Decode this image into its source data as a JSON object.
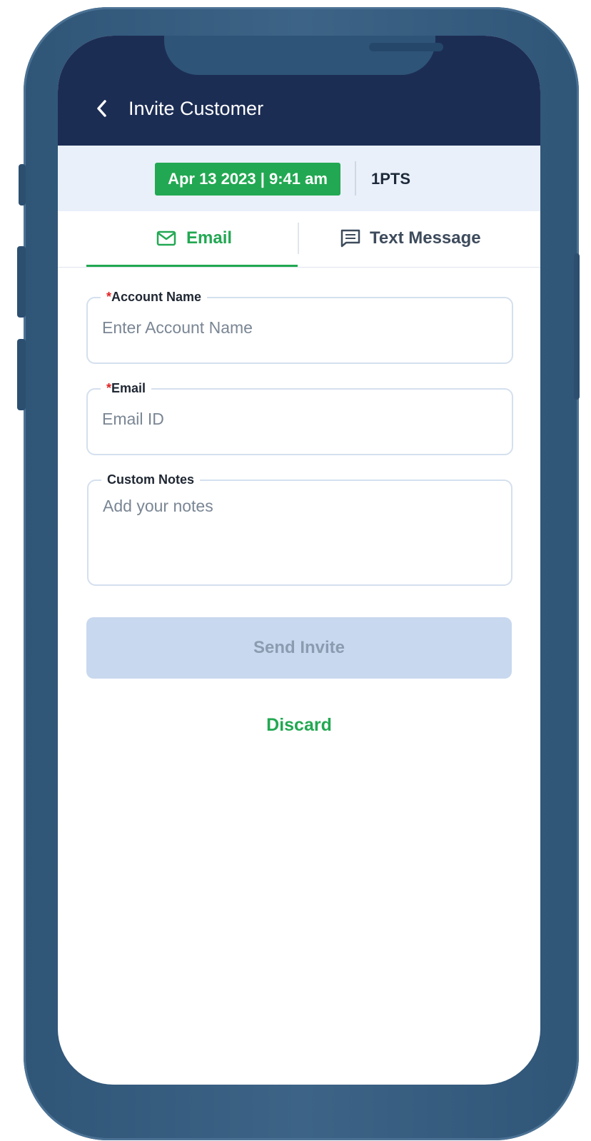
{
  "header": {
    "title": "Invite Customer"
  },
  "status": {
    "datetime": "Apr 13 2023 | 9:41 am",
    "points": "1PTS"
  },
  "tabs": [
    {
      "label": "Email",
      "icon": "mail-icon",
      "active": true
    },
    {
      "label": "Text Message",
      "icon": "message-icon",
      "active": false
    }
  ],
  "form": {
    "account_name": {
      "label": "Account Name",
      "required_marker": "*",
      "placeholder": "Enter Account Name",
      "value": ""
    },
    "email": {
      "label": "Email",
      "required_marker": "*",
      "placeholder": "Email ID",
      "value": ""
    },
    "notes": {
      "label": "Custom Notes",
      "placeholder": "Add your notes",
      "value": ""
    }
  },
  "actions": {
    "send_label": "Send Invite",
    "discard_label": "Discard"
  },
  "colors": {
    "primary_green": "#22a852",
    "header_navy": "#1c2d54",
    "disabled_button": "#c8d8ee",
    "required_red": "#e02424"
  }
}
